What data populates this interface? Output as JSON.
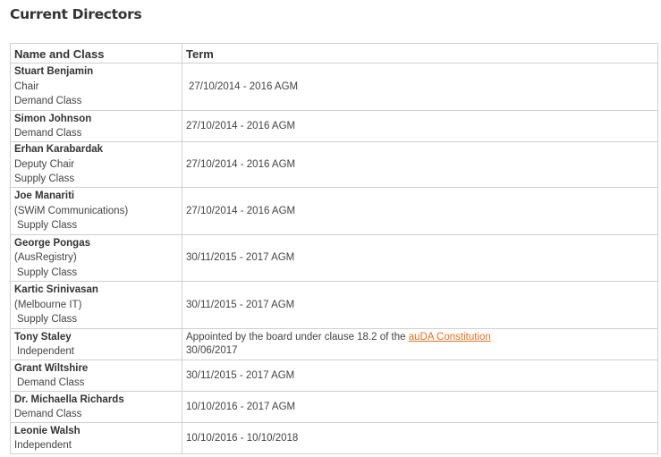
{
  "page": {
    "heading": "Current Directors"
  },
  "table": {
    "headers": {
      "name": "Name and Class",
      "term": "Term"
    },
    "rows": [
      {
        "name": "Stuart Benjamin",
        "lines": [
          "Chair",
          "Demand Class"
        ],
        "term": " 27/10/2014 -  2016 AGM"
      },
      {
        "name": "Simon Johnson",
        "lines": [
          "Demand Class"
        ],
        "term": "27/10/2014 -  2016 AGM"
      },
      {
        "name": "Erhan Karabardak",
        "lines": [
          "Deputy Chair",
          "Supply Class"
        ],
        "term": "27/10/2014 - 2016 AGM"
      },
      {
        "name": "Joe Manariti",
        "lines": [
          "(SWiM Communications)",
          " Supply Class"
        ],
        "term": "27/10/2014 - 2016 AGM"
      },
      {
        "name": "George Pongas",
        "lines": [
          "(AusRegistry)",
          " Supply Class"
        ],
        "term": "30/11/2015 - 2017 AGM"
      },
      {
        "name": "Kartic Srinivasan",
        "lines": [
          "(Melbourne IT)",
          " Supply Class"
        ],
        "term": "30/11/2015 - 2017 AGM"
      },
      {
        "name": "Tony Staley",
        "lines": [
          " Independent"
        ],
        "term_prefix": "Appointed by the board under clause 18.2 of the ",
        "term_link": "auDA Constitution",
        "term": "30/06/2017"
      },
      {
        "name": "Grant Wiltshire",
        "lines": [
          " Demand Class"
        ],
        "term": "30/11/2015 - 2017 AGM"
      },
      {
        "name": "Dr. Michaella Richards",
        "lines": [
          "Demand Class"
        ],
        "term": "10/10/2016 - 2017 AGM"
      },
      {
        "name": "Leonie Walsh",
        "lines": [
          "Independent"
        ],
        "term": "10/10/2016 - 10/10/2018"
      }
    ]
  },
  "colors": {
    "text": "#333333",
    "border": "#cfcfcf",
    "link": "#e8711f"
  }
}
